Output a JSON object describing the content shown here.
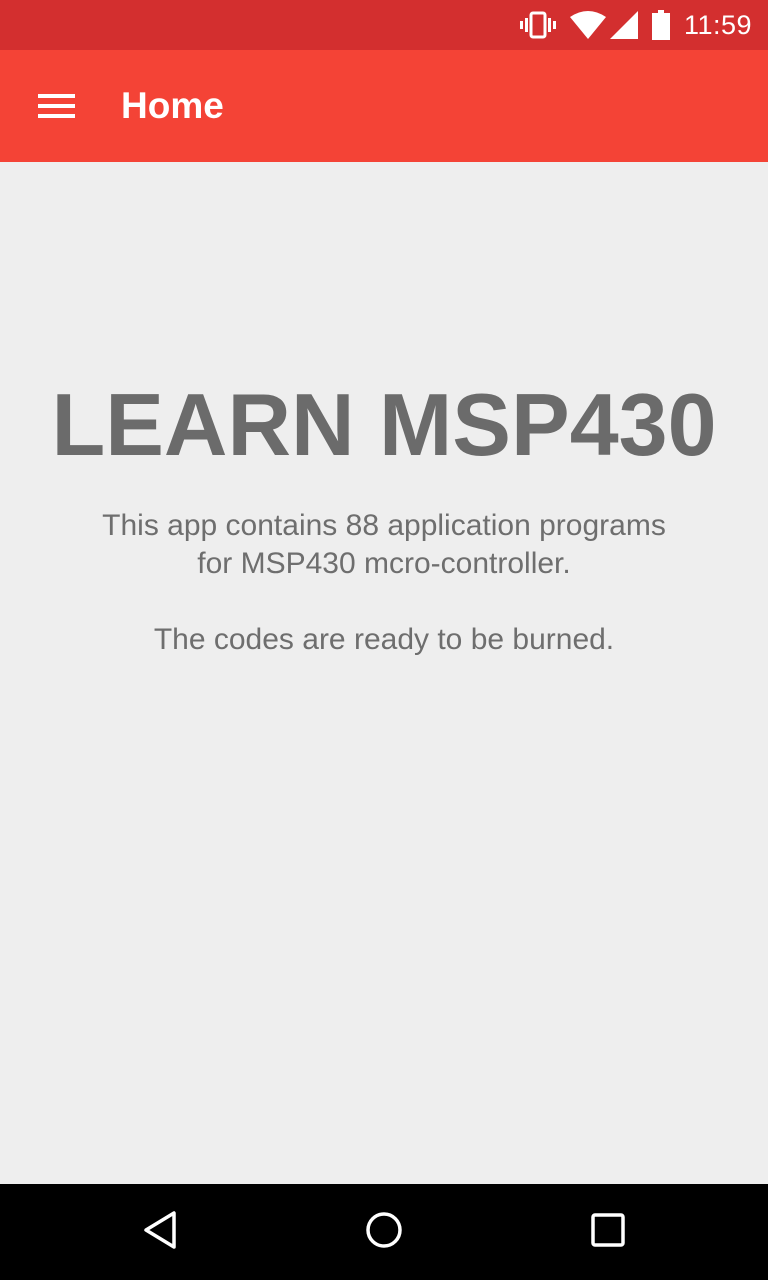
{
  "status_bar": {
    "time": "11:59",
    "icons": [
      "vibrate-icon",
      "wifi-icon",
      "cell-signal-icon",
      "battery-icon"
    ],
    "color": "#d32f2f"
  },
  "app_bar": {
    "title": "Home",
    "menu_icon": "menu-icon",
    "color": "#f44336"
  },
  "main": {
    "headline": "LEARN MSP430",
    "description": "This app contains 88 application programs for MSP430 mcro-controller.",
    "note": "The codes are ready to be burned.",
    "text_color": "#6e6e6e"
  },
  "nav_bar": {
    "buttons": [
      "back-icon",
      "home-icon",
      "recents-icon"
    ]
  }
}
